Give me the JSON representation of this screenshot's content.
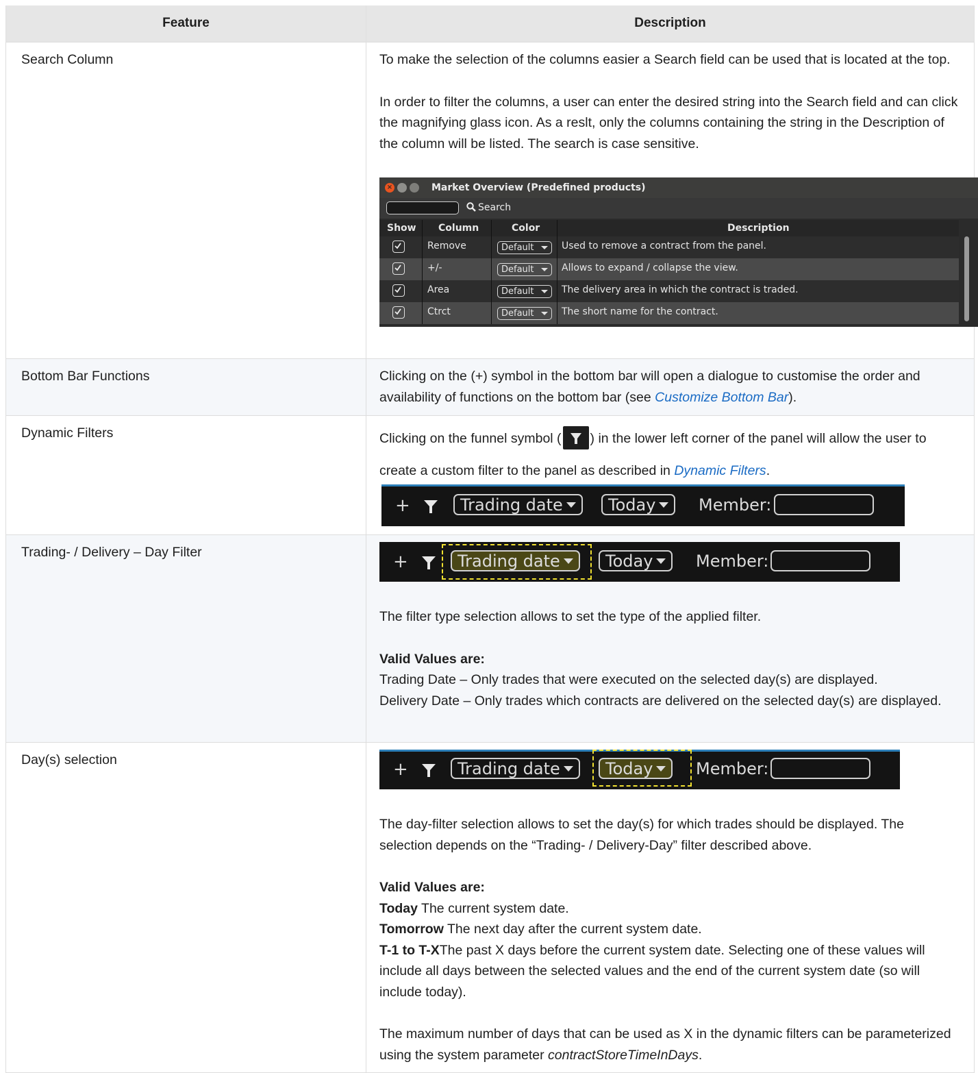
{
  "table": {
    "header_feature": "Feature",
    "header_description": "Description"
  },
  "rows": {
    "search": {
      "feature": "Search Column",
      "p1": "To make the selection of the columns easier a Search field can be used that is located at the top.",
      "p2": "In order to filter the columns, a user can enter the desired string into the Search field and can click the magnifying glass icon. As a reslt, only the columns containing the string in the Description of the column will be listed. The search is case sensitive."
    },
    "bottom_bar": {
      "feature": "Bottom Bar Functions",
      "text_before": "Clicking on the (+) symbol in the bottom bar will open a dialogue to customise the order and availability of functions on the bottom bar (see ",
      "link": "Customize Bottom Bar",
      "text_after": ")."
    },
    "dynamic": {
      "feature": "Dynamic Filters",
      "text_before": "Clicking on the funnel symbol (",
      "text_mid": ") in the lower left corner of the panel will allow the user to create a custom filter to the panel as described in ",
      "link": "Dynamic Filters",
      "text_after": "."
    },
    "trading_day": {
      "feature": "Trading- / Delivery – Day Filter",
      "p1": "The filter type selection allows to set the type of the applied filter.",
      "valid_heading": "Valid Values are:",
      "v1": "Trading Date – Only trades that were executed on the selected day(s) are displayed.",
      "v2": "Delivery Date – Only trades which contracts are delivered on the selected day(s) are displayed."
    },
    "day_selection": {
      "feature": "Day(s) selection",
      "p1": "The day-filter selection allows to set the day(s) for which trades should be displayed. The selection depends on the “Trading- / Delivery-Day” filter described above.",
      "valid_heading": "Valid Values are:",
      "today_b": "Today",
      "today_t": " The current system date.",
      "tomorrow_b": "Tomorrow",
      "tomorrow_t": " The next day after the current system date.",
      "tx_b": "T-1 to T-X",
      "tx_t": "The past X days before the current system date. Selecting one of these values will include all days between the selected values and the end of the current system date (so will include today).",
      "p_last_before": "The maximum number of days that can be used as X in the dynamic filters can be parameterized using the system parameter ",
      "p_last_param": "contractStoreTimeInDays",
      "p_last_after": "."
    }
  },
  "market_overview": {
    "title": "Market Overview (Predefined products)",
    "close_glyph": "×",
    "search_label": "Search",
    "columns": [
      "Show",
      "Column",
      "Color",
      "Description"
    ],
    "rows": [
      {
        "column": "Remove",
        "color": "Default",
        "description": "Used to remove a contract from the panel."
      },
      {
        "column": "+/-",
        "color": "Default",
        "description": "Allows to expand / collapse the view."
      },
      {
        "column": "Area",
        "color": "Default",
        "description": "The delivery area in which the contract is traded."
      },
      {
        "column": "Ctrct",
        "color": "Default",
        "description": "The short name for the contract."
      }
    ]
  },
  "bottom_bar": {
    "plus": "+",
    "filter_type": "Trading date",
    "day": "Today",
    "member_label": "Member:"
  }
}
